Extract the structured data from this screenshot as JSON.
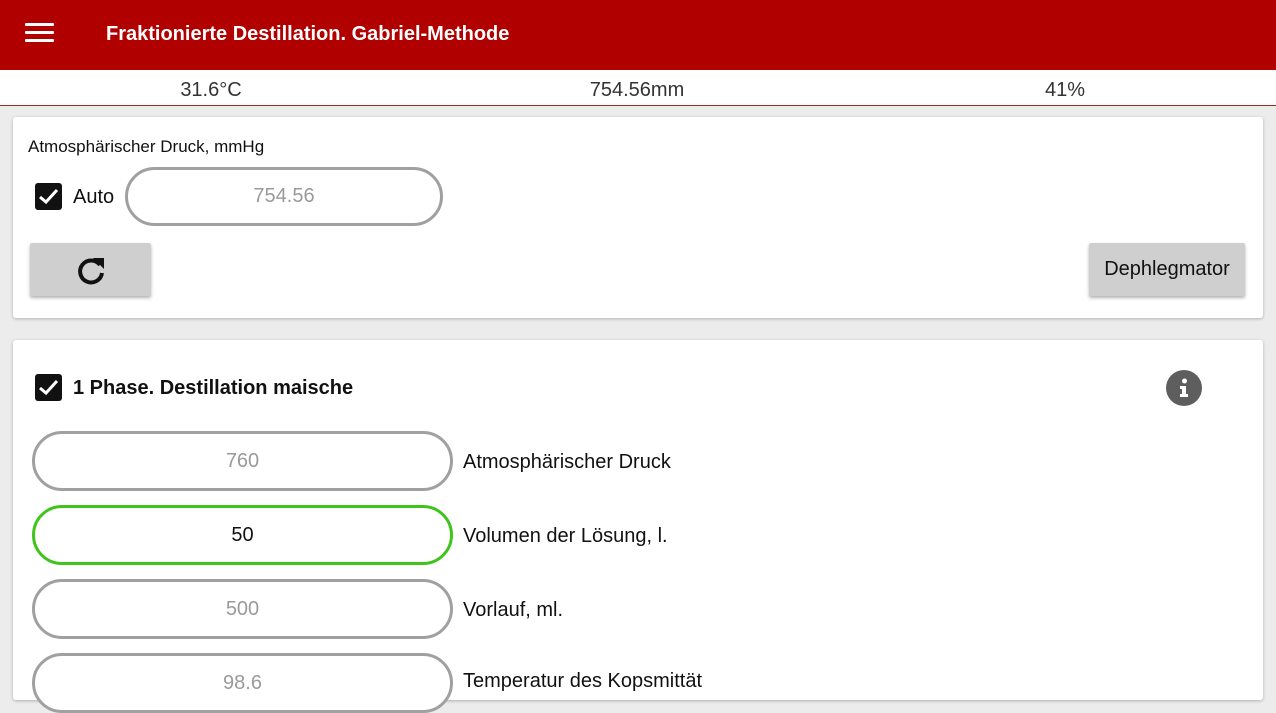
{
  "appbar": {
    "title": "Fraktionierte Destillation. Gabriel-Methode",
    "menu_icon": "menu-icon",
    "background": "#b00000"
  },
  "status": {
    "temperature": "31.6°C",
    "pressure": "754.56mm",
    "humidity": "41%"
  },
  "pressure_card": {
    "label": "Atmosphärischer Druck, mmHg",
    "auto_label": "Auto",
    "auto_checked": true,
    "pressure_value": "754.56",
    "refresh_icon": "refresh-icon",
    "dephlegmator_label": "Dephlegmator"
  },
  "phase1": {
    "checked": true,
    "title": "1 Phase. Destillation maische",
    "info_icon": "info-icon",
    "rows": [
      {
        "value": "760",
        "label": "Atmosphärischer Druck"
      },
      {
        "value": "50",
        "label": "Volumen der Lösung, l."
      },
      {
        "value": "500",
        "label": "Vorlauf, ml."
      },
      {
        "value": "98.6",
        "label": "Temperatur des Kopsmittät"
      }
    ]
  },
  "colors": {
    "accent": "#b00000",
    "active_border": "#3fc41c"
  }
}
